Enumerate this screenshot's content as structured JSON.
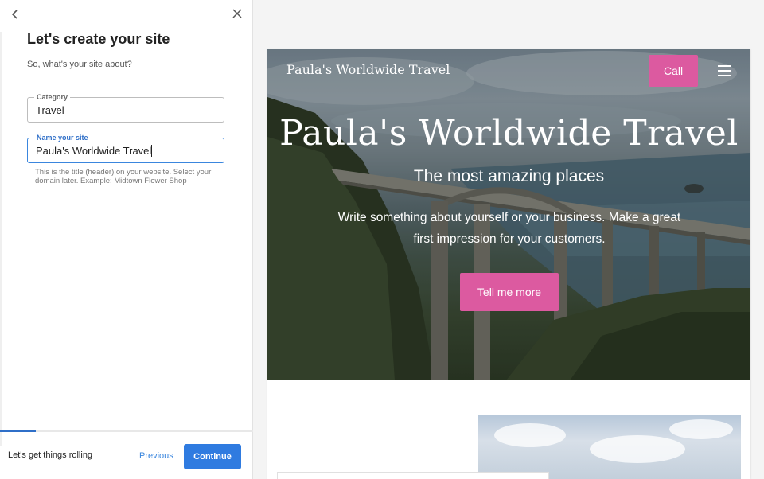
{
  "panel": {
    "title": "Let's create your site",
    "subtitle": "So, what's your site about?",
    "category": {
      "label": "Category",
      "value": "Travel"
    },
    "site_name": {
      "label": "Name your site",
      "value": "Paula's Worldwide Travel"
    },
    "hint": "This is the title (header) on your website. Select your domain later. Example: Midtown Flower Shop",
    "progress": 0.14,
    "footer_text": "Let's get things rolling",
    "previous_label": "Previous",
    "continue_label": "Continue"
  },
  "preview": {
    "site_name": "Paula's Worldwide Travel",
    "call_label": "Call",
    "hero_title": "Paula's Worldwide Travel",
    "hero_subtitle": "The most amazing places",
    "hero_desc": "Write something about yourself or your business. Make a great first impression for your customers.",
    "cta_label": "Tell me more"
  },
  "colors": {
    "accent_pink": "#dc5aa0",
    "primary_blue": "#2f7be0",
    "focus_blue": "#3a86de"
  },
  "icons": {
    "back": "chevron-left-icon",
    "close": "close-icon",
    "menu": "hamburger-menu-icon"
  }
}
